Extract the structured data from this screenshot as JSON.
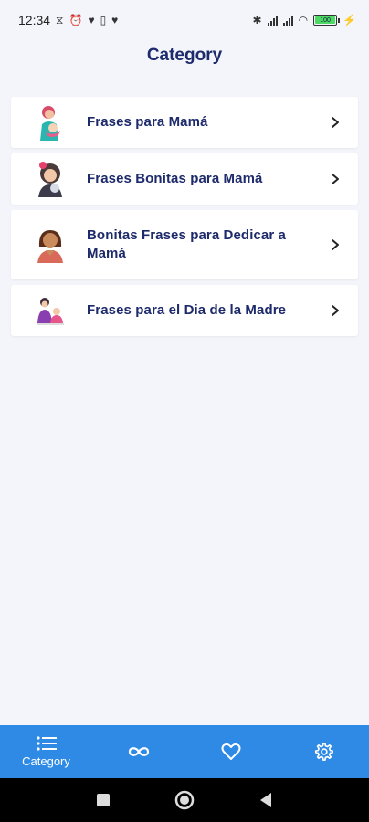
{
  "status_bar": {
    "time": "12:34",
    "battery_level": "100"
  },
  "header": {
    "title": "Category"
  },
  "categories": [
    {
      "label": "Frases para Mamá",
      "icon": "mother-baby-icon"
    },
    {
      "label": "Frases Bonitas para Mamá",
      "icon": "mother-daughter-icon"
    },
    {
      "label": "Bonitas Frases para Dedicar a Mamá",
      "icon": "woman-avatar-icon"
    },
    {
      "label": "Frases para el Dia de la Madre",
      "icon": "mother-child-icon"
    }
  ],
  "bottom_nav": {
    "items": [
      {
        "label": "Category",
        "icon": "list-icon",
        "active": true
      },
      {
        "label": "",
        "icon": "infinity-icon"
      },
      {
        "label": "",
        "icon": "heart-icon"
      },
      {
        "label": "",
        "icon": "gear-icon"
      }
    ]
  },
  "colors": {
    "background": "#f3f5fa",
    "accent": "#2f8ae6",
    "title": "#1d2a6b",
    "card": "#ffffff"
  }
}
